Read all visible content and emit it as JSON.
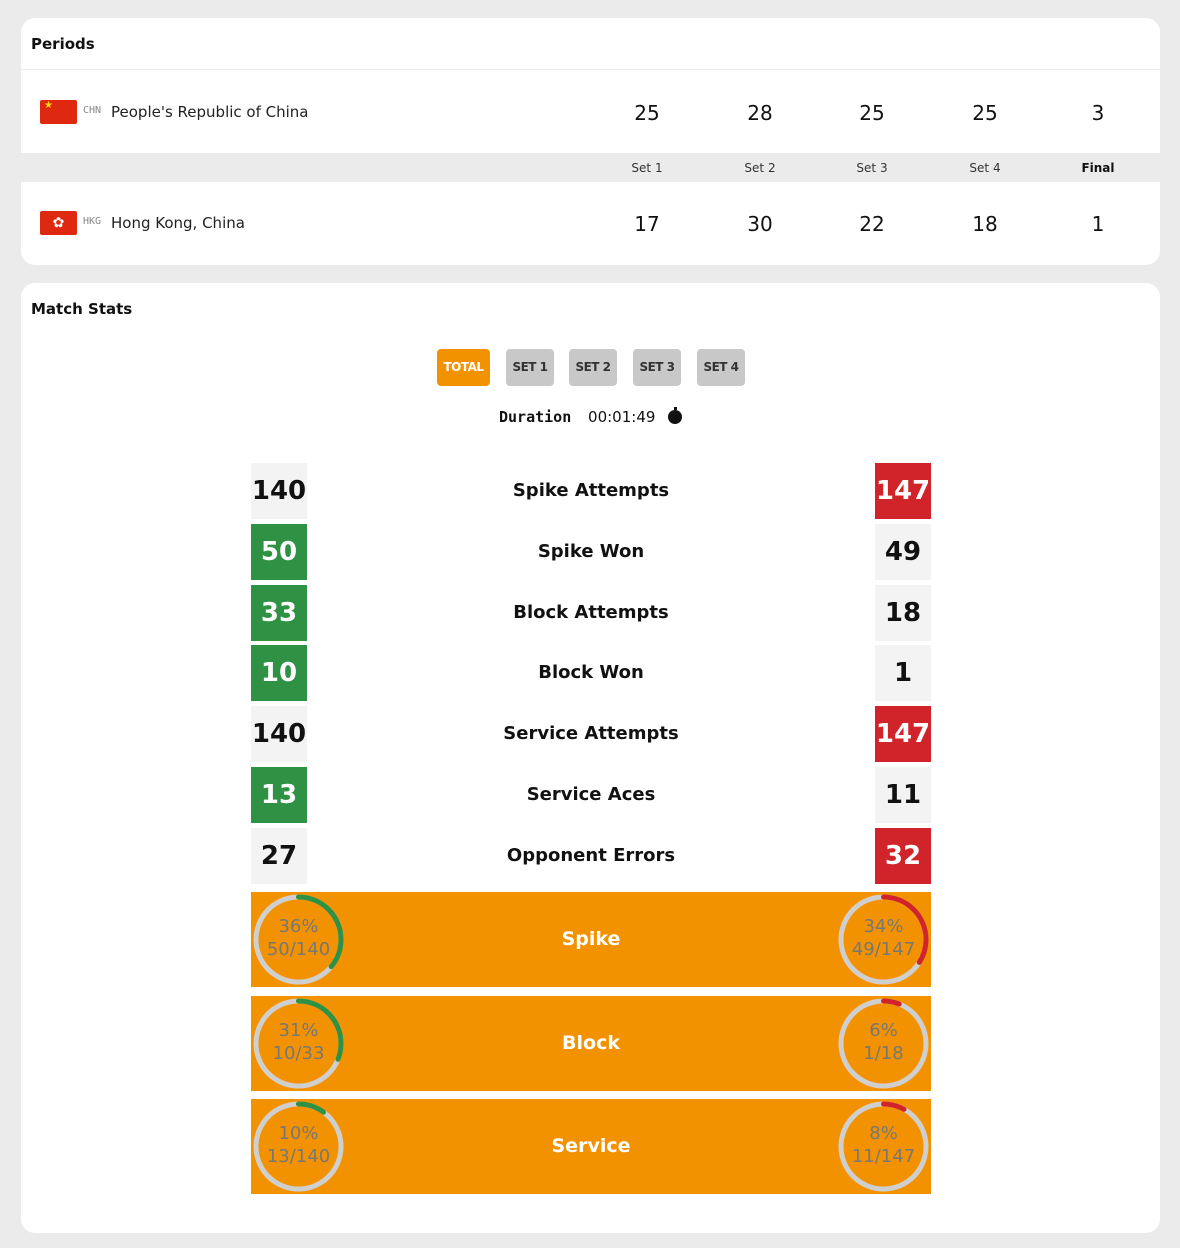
{
  "periods": {
    "title": "Periods",
    "teams": [
      {
        "code": "CHN",
        "name": "People's Republic of China",
        "flag": "★",
        "scores": [
          "25",
          "28",
          "25",
          "25",
          "3"
        ]
      },
      {
        "code": "HKG",
        "name": "Hong Kong, China",
        "flag": "✿",
        "scores": [
          "17",
          "30",
          "22",
          "18",
          "1"
        ]
      }
    ],
    "headers": [
      "Set 1",
      "Set 2",
      "Set 3",
      "Set 4",
      "Final"
    ]
  },
  "match_stats": {
    "title": "Match Stats",
    "tabs": [
      "TOTAL",
      "SET 1",
      "SET 2",
      "SET 3",
      "SET 4"
    ],
    "active_tab": "TOTAL",
    "duration_label": "Duration",
    "duration_value": "00:01:49",
    "stats": [
      {
        "label": "Spike Attempts",
        "left": "140",
        "right": "147",
        "left_state": "neutral",
        "right_state": "red"
      },
      {
        "label": "Spike Won",
        "left": "50",
        "right": "49",
        "left_state": "green",
        "right_state": "neutral"
      },
      {
        "label": "Block Attempts",
        "left": "33",
        "right": "18",
        "left_state": "green",
        "right_state": "neutral"
      },
      {
        "label": "Block Won",
        "left": "10",
        "right": "1",
        "left_state": "green",
        "right_state": "neutral"
      },
      {
        "label": "Service Attempts",
        "left": "140",
        "right": "147",
        "left_state": "neutral",
        "right_state": "red"
      },
      {
        "label": "Service Aces",
        "left": "13",
        "right": "11",
        "left_state": "green",
        "right_state": "neutral"
      },
      {
        "label": "Opponent Errors",
        "left": "27",
        "right": "32",
        "left_state": "neutral",
        "right_state": "red"
      }
    ],
    "percentages": [
      {
        "label": "Spike",
        "left_pct": "36%",
        "left_ratio": "50/140",
        "left_value": 0.36,
        "right_pct": "34%",
        "right_ratio": "49/147",
        "right_value": 0.34
      },
      {
        "label": "Block",
        "left_pct": "31%",
        "left_ratio": "10/33",
        "left_value": 0.31,
        "right_pct": "6%",
        "right_ratio": "1/18",
        "right_value": 0.06
      },
      {
        "label": "Service",
        "left_pct": "10%",
        "left_ratio": "13/140",
        "left_value": 0.1,
        "right_pct": "8%",
        "right_ratio": "11/147",
        "right_value": 0.08
      }
    ]
  },
  "colors": {
    "accent": "#f39200",
    "green": "#2e9144",
    "red": "#d1232a"
  }
}
